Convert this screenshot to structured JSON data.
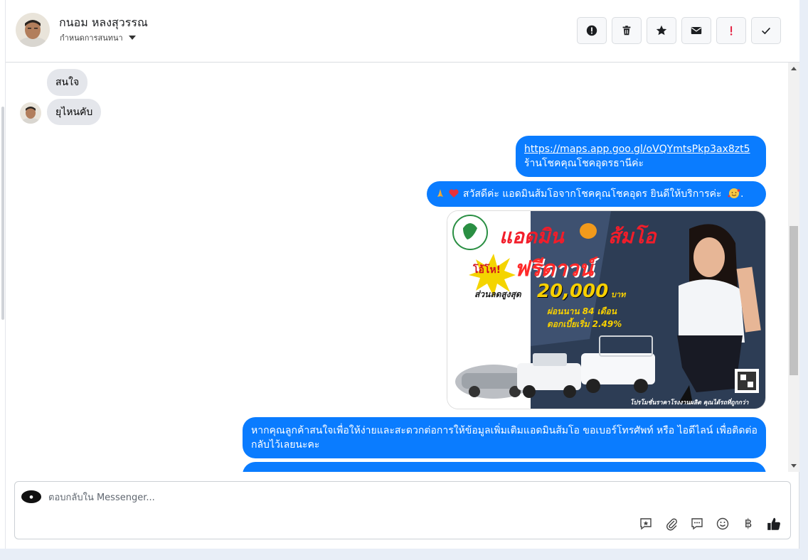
{
  "header": {
    "contact_name": "กนอม หลงสุวรรณ",
    "assign_label": "กำหนดการสนทนา",
    "actions": [
      "mark-spam",
      "delete",
      "star",
      "mark-unread",
      "important",
      "done"
    ]
  },
  "messages": {
    "incoming": [
      {
        "text": "สนใจ"
      },
      {
        "text": "ยุไหนคับ"
      }
    ],
    "outgoing": [
      {
        "link": "https://maps.app.goo.gl/oVQYmtsPkp3ax8zt5",
        "text": "ร้านโชคคุณโชคอุดรธานีค่ะ"
      },
      {
        "text": "สวัสดีค่ะ แอดมินส้มโอจากโชคคุณโชคอุดร ยินดีให้บริการค่ะ",
        "suffix": "."
      },
      {
        "text": "หากคุณลูกค้าสนใจเพื่อให้ง่ายและสะดวกต่อการให้ข้อมูลเพิ่มเติมแอดมินส้มโอ ขอเบอร์โทรศัพท์ หรือ ไอดีไลน์ เพื่อติดต่อกลับไว้เลยนะคะ"
      }
    ]
  },
  "promo_image": {
    "headline_left": "แอดมิน",
    "headline_right": "ส้มโอ",
    "badge": "โอ้โห!",
    "title": "ฟรีดาวน์",
    "discount_label": "ส่วนลดสูงสุด",
    "discount_value": "20,000",
    "discount_unit": "บาท",
    "installment": "ผ่อนนาน 84 เดือน",
    "interest": "ดอกเบี้ยเริ่ม 2.49%",
    "footer": "โปรโมชั่นราคาโรงงานผลิต คุณได้รถที่ถูกกว่า"
  },
  "composer": {
    "placeholder": "ตอบกลับใน Messenger..."
  },
  "colors": {
    "outgoing_bubble": "#0a7cff",
    "incoming_bubble": "#e4e6eb"
  }
}
